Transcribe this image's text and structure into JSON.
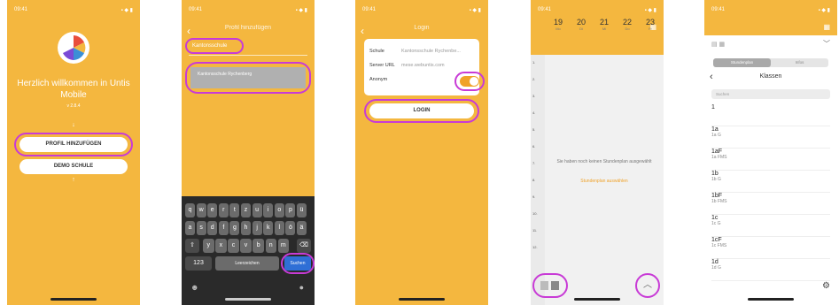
{
  "colors": {
    "accent": "#f4b73f",
    "highlight": "#c83bd6",
    "toggle": "#f0a22a"
  },
  "phone1": {
    "title": "Herzlich willkommen in Untis Mobile",
    "version": "v 2.8.4",
    "profile_button": "PROFIL HINZUFÜGEN",
    "demo_button": "DEMO SCHULE"
  },
  "phone2": {
    "nav_title": "Profil hinzufügen",
    "search_value": "Kantonsschule",
    "suggestion": "Kantonsschule Rychenberg",
    "keyboard": {
      "row1": [
        "q",
        "w",
        "e",
        "r",
        "t",
        "z",
        "u",
        "i",
        "o",
        "p",
        "ü"
      ],
      "row2": [
        "a",
        "s",
        "d",
        "f",
        "g",
        "h",
        "j",
        "k",
        "l",
        "ö",
        "ä"
      ],
      "row3": [
        "y",
        "x",
        "c",
        "v",
        "b",
        "n",
        "m"
      ],
      "num_key": "123",
      "space_key": "Leerzeichen",
      "search_key": "Suchen"
    }
  },
  "phone3": {
    "nav_title": "Login",
    "school_label": "Schule",
    "school_value": "Kantonsschule Rychenbe...",
    "server_label": "Server URL",
    "server_value": "mese.webuntis.com",
    "anonym_label": "Anonym",
    "login_button": "LOGIN"
  },
  "phone4": {
    "days": [
      {
        "num": "19",
        "wd": "Mo"
      },
      {
        "num": "20",
        "wd": "Di"
      },
      {
        "num": "21",
        "wd": "Mi"
      },
      {
        "num": "22",
        "wd": "Do"
      },
      {
        "num": "23",
        "wd": "Fr"
      }
    ],
    "hours": [
      "1.",
      "2.",
      "3.",
      "4.",
      "5.",
      "6.",
      "7.",
      "8.",
      "9.",
      "10.",
      "11.",
      "12."
    ],
    "empty_message": "Sie haben noch keinen Stundenplan ausgewählt",
    "empty_link": "Stundenplan auswählen"
  },
  "phone5": {
    "segments": [
      "Stundenplan",
      "Infos"
    ],
    "nav_title": "Klassen",
    "search_placeholder": "Suchen",
    "classes": [
      {
        "code": "1",
        "name": ""
      },
      {
        "code": "1a",
        "name": "1a G"
      },
      {
        "code": "1aF",
        "name": "1a FMS"
      },
      {
        "code": "1b",
        "name": "1b G"
      },
      {
        "code": "1bF",
        "name": "1b FMS"
      },
      {
        "code": "1c",
        "name": "1c G"
      },
      {
        "code": "1cF",
        "name": "1c FMS"
      },
      {
        "code": "1d",
        "name": "1d G"
      }
    ]
  }
}
